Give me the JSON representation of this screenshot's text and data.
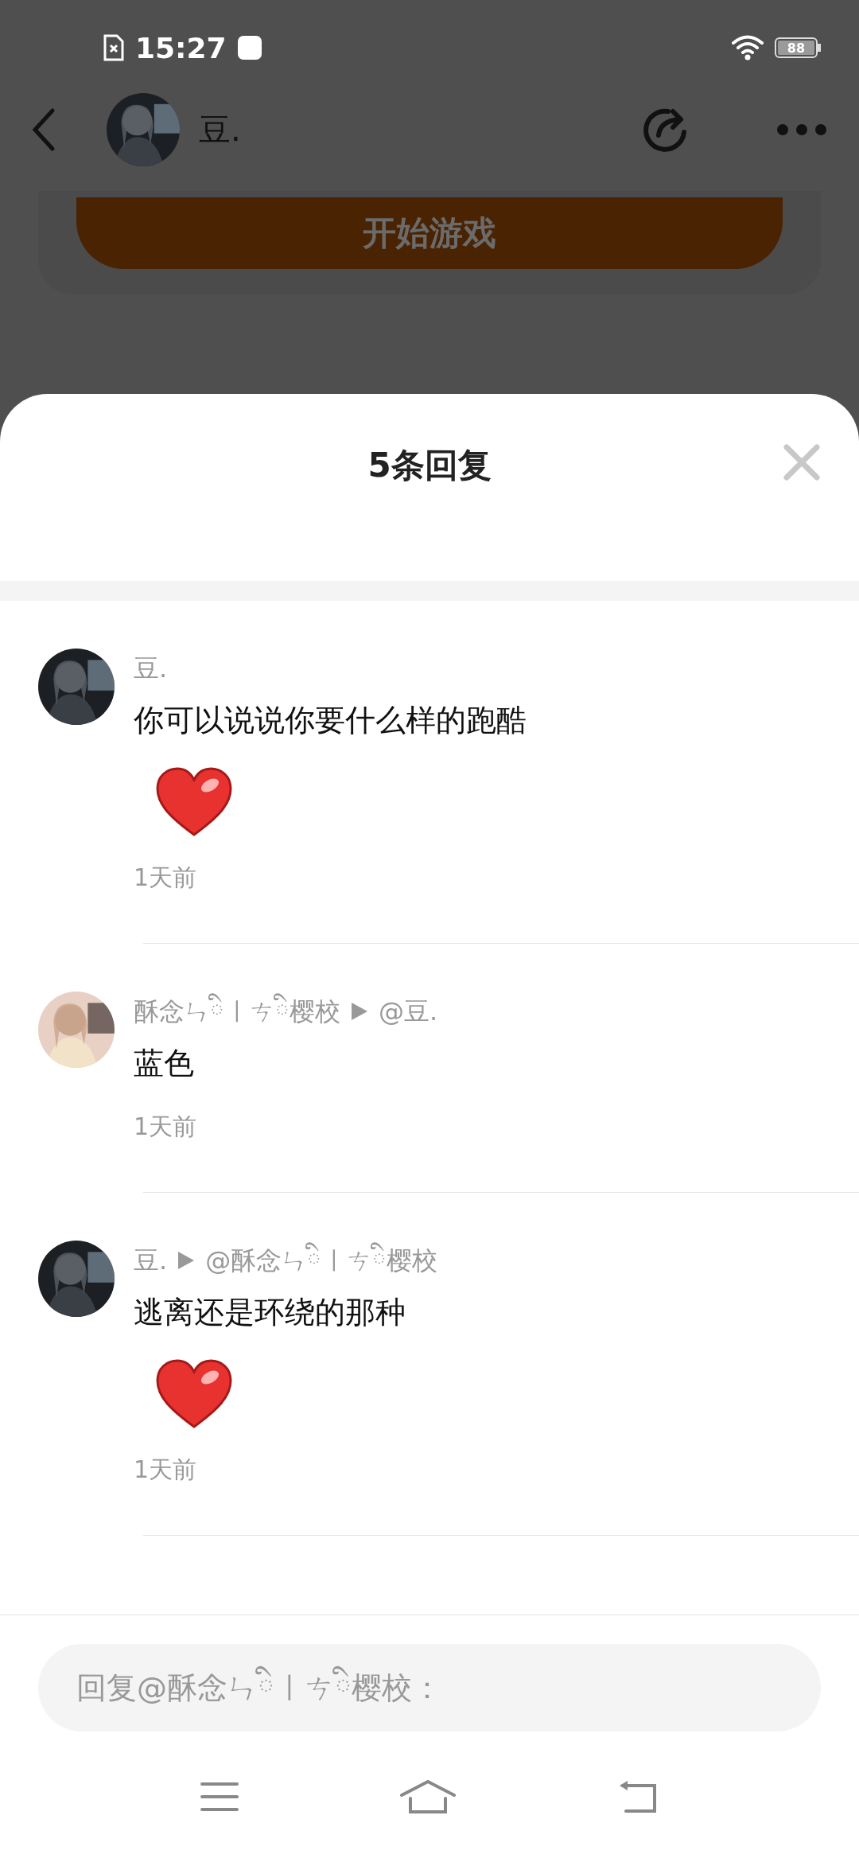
{
  "status_bar": {
    "time": "15:27",
    "battery": "88"
  },
  "header": {
    "title": "豆.",
    "start_button": "开始游戏"
  },
  "sheet": {
    "title": "5条回复",
    "replies": [
      {
        "author": "豆.",
        "content": "你可以说说你要什么样的跑酷",
        "heart": true,
        "time": "1天前"
      },
      {
        "author": "酥念ㄣིㅣㄘི樱校",
        "reply_to": "@豆.",
        "content": "蓝色",
        "heart": false,
        "time": "1天前"
      },
      {
        "author": "豆.",
        "reply_to": "@酥念ㄣིㅣㄘི樱校",
        "content": "逃离还是环绕的那种",
        "heart": true,
        "time": "1天前"
      }
    ],
    "reply_field": {
      "placeholder": "回复@酥念ㄣིㅣㄘི樱校："
    }
  }
}
